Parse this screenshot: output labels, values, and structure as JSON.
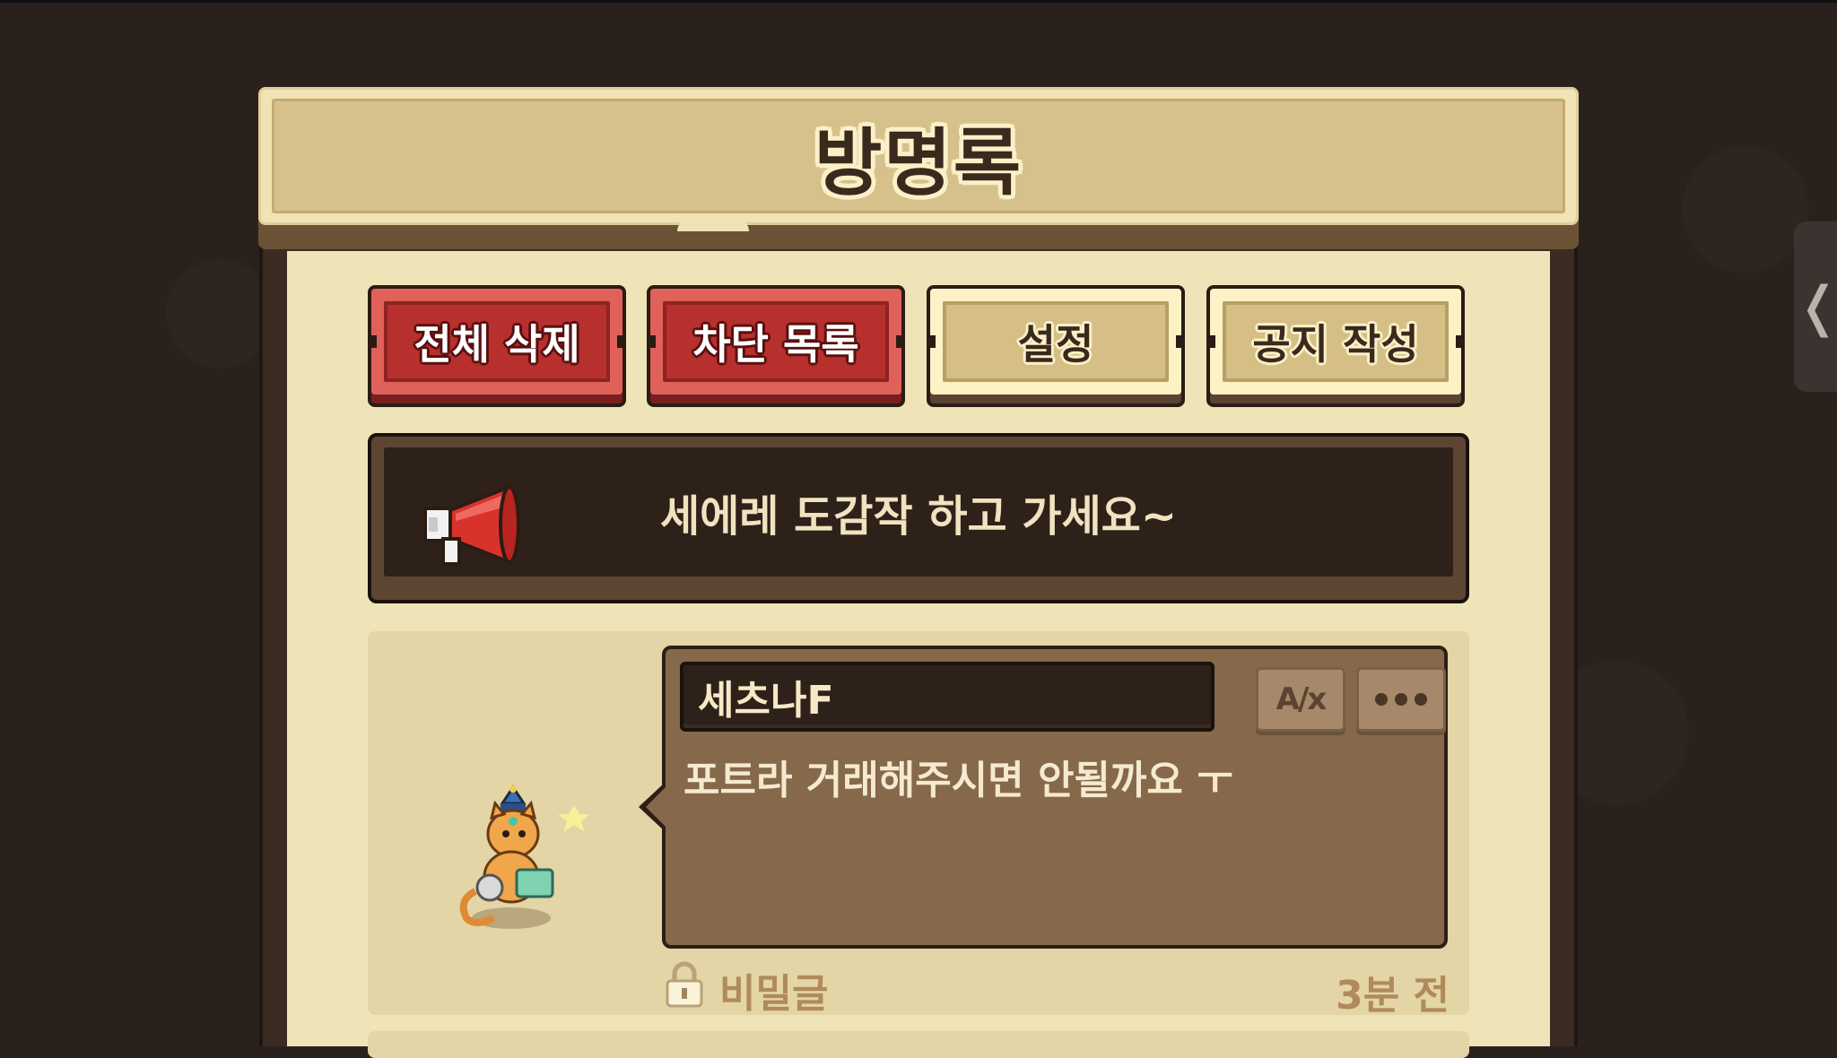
{
  "title": "방명록",
  "buttons": {
    "delete_all": "전체 삭제",
    "block_list": "차단 목록",
    "settings": "설정",
    "write_notice": "공지 작성"
  },
  "notice": {
    "text": "세에레 도감작 하고 가세요~",
    "icon": "megaphone-icon"
  },
  "entry": {
    "author": "세츠나F",
    "message": "포트라 거래해주시면 안될까요 ㅜ",
    "translate_glyph": "A/x",
    "secret_label": "비밀글",
    "time": "3분 전"
  },
  "side_tab": {
    "glyph": "❬"
  },
  "colors": {
    "background": "#2b211c",
    "paper": "#efe3b8",
    "red_button": "#b7302e",
    "tan_button": "#d5bf86",
    "notice_bg": "#2e2119",
    "bubble": "#86684a",
    "meta_text": "#b08a5c"
  }
}
